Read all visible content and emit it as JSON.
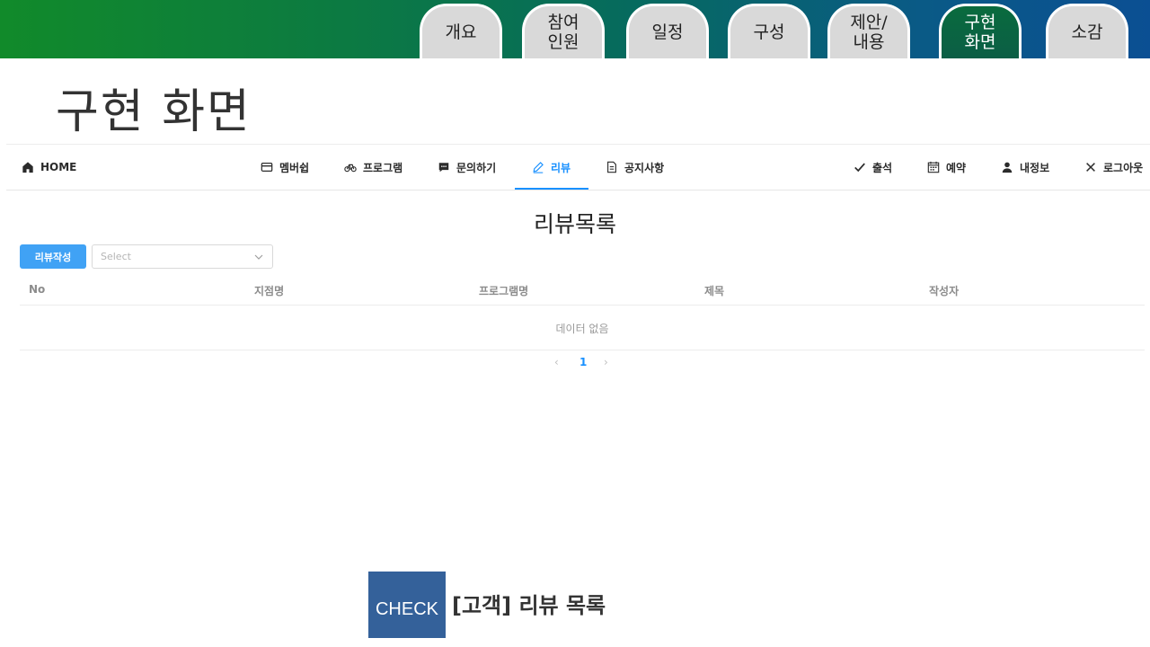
{
  "slide_tabs": [
    {
      "label": "개요",
      "active": false
    },
    {
      "label": "참여\n인원",
      "active": false
    },
    {
      "label": "일정",
      "active": false
    },
    {
      "label": "구성",
      "active": false
    },
    {
      "label": "제안/\n내용",
      "active": false
    },
    {
      "label": "구현\n화면",
      "active": true
    },
    {
      "label": "소감",
      "active": false
    }
  ],
  "slide_title": "구현 화면",
  "app_nav": {
    "home": "HOME",
    "membership": "멤버쉽",
    "program": "프로그램",
    "inquiry": "문의하기",
    "review": "리뷰",
    "notice": "공지사항",
    "attendance": "출석",
    "reservation": "예약",
    "my_info": "내정보",
    "logout": "로그아웃"
  },
  "list_title": "리뷰목록",
  "write_button": "리뷰작성",
  "select": {
    "placeholder": "Select"
  },
  "table": {
    "columns": [
      "No",
      "지점명",
      "프로그램명",
      "제목",
      "작성자"
    ],
    "empty_text": "데이터 없음"
  },
  "pagination": {
    "prev": "‹",
    "current_page": "1",
    "next": "›"
  },
  "check_badge": "CHECK",
  "check_caption": "[고객] 리뷰 목록",
  "colors": {
    "accent": "#1890ff",
    "button": "#40a2f5",
    "check_badge": "#34619a"
  }
}
